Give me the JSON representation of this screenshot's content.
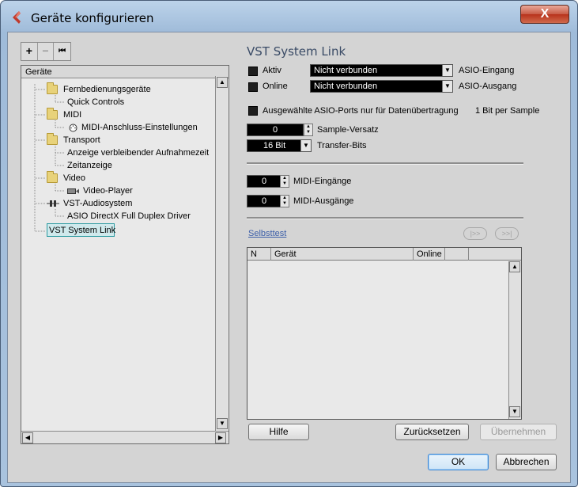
{
  "window": {
    "title": "Geräte konfigurieren",
    "close_glyph": "X"
  },
  "tree": {
    "header": "Geräte",
    "toolbar": {
      "add": "+",
      "remove": "−",
      "reset": "⏮"
    },
    "nodes": [
      {
        "label": "Fernbedienungsgeräte",
        "icon": "folder-icon"
      },
      {
        "label": "Quick Controls",
        "icon": ""
      },
      {
        "label": "MIDI",
        "icon": "folder-icon"
      },
      {
        "label": "MIDI-Anschluss-Einstellungen",
        "icon": "midi-port-icon"
      },
      {
        "label": "Transport",
        "icon": "folder-icon"
      },
      {
        "label": "Anzeige verbleibender Aufnahmezeit",
        "icon": ""
      },
      {
        "label": "Zeitanzeige",
        "icon": ""
      },
      {
        "label": "Video",
        "icon": "folder-icon"
      },
      {
        "label": "Video-Player",
        "icon": "video-player-icon"
      },
      {
        "label": "VST-Audiosystem",
        "icon": "audio-system-icon"
      },
      {
        "label": "ASIO DirectX Full Duplex Driver",
        "icon": ""
      },
      {
        "label": "VST System Link",
        "icon": ""
      }
    ]
  },
  "panel": {
    "title": "VST System Link",
    "aktiv_label": "Aktiv",
    "online_label": "Online",
    "input_select": "Nicht verbunden",
    "output_select": "Nicht verbunden",
    "asio_input_label": "ASIO-Eingang",
    "asio_output_label": "ASIO-Ausgang",
    "data_only_label": "Ausgewählte ASIO-Ports nur für Datenübertragung",
    "bit_per_sample": "1 Bit per Sample",
    "sample_offset_value": "0",
    "sample_offset_label": "Sample-Versatz",
    "transfer_bits_value": "16 Bit",
    "transfer_bits_label": "Transfer-Bits",
    "midi_inputs_value": "0",
    "midi_inputs_label": "MIDI-Eingänge",
    "midi_outputs_value": "0",
    "midi_outputs_label": "MIDI-Ausgänge",
    "selftest_link": "Selbsttest",
    "nav_prev": "|>>",
    "nav_next": ">>|",
    "table_columns": [
      "N",
      "Gerät",
      "Online",
      ""
    ]
  },
  "buttons": {
    "help": "Hilfe",
    "reset": "Zurücksetzen",
    "apply": "Übernehmen",
    "ok": "OK",
    "cancel": "Abbrechen"
  },
  "colors": {
    "title_accent": "#3a4b66",
    "selection_border": "#2b9aa0",
    "link": "#3b5ea8"
  }
}
